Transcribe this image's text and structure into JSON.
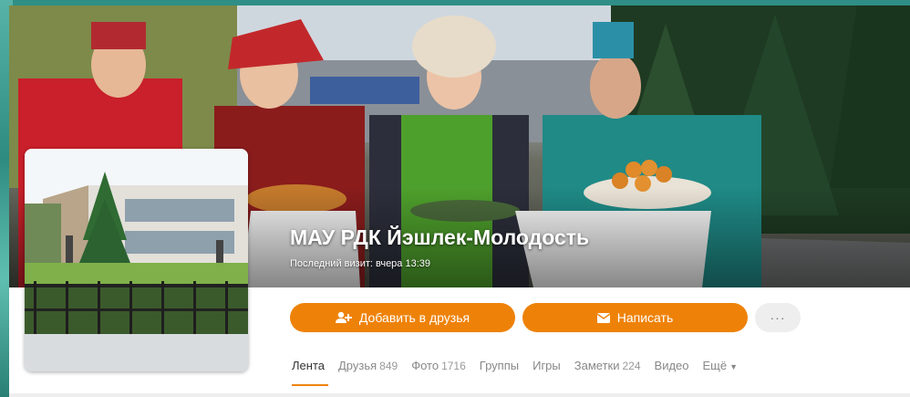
{
  "profile": {
    "name": "МАУ РДК Йэшлек-Молодость",
    "last_visit": "Последний визит: вчера 13:39"
  },
  "actions": {
    "add_friend": "Добавить в друзья",
    "write": "Написать",
    "more": "···"
  },
  "tabs": [
    {
      "label": "Лента",
      "count": ""
    },
    {
      "label": "Друзья",
      "count": "849"
    },
    {
      "label": "Фото",
      "count": "1716"
    },
    {
      "label": "Группы",
      "count": ""
    },
    {
      "label": "Игры",
      "count": ""
    },
    {
      "label": "Заметки",
      "count": "224"
    },
    {
      "label": "Видео",
      "count": ""
    },
    {
      "label": "Ещё",
      "count": ""
    }
  ],
  "icons": {
    "add_friend": "user-plus-icon",
    "write": "envelope-icon",
    "more": "ellipsis-icon",
    "dropdown": "triangle-down-icon"
  },
  "colors": {
    "accent": "#ee8208",
    "active_tab_text": "#333333",
    "tab_text": "#888888",
    "more_button_bg": "#eeeeee"
  }
}
